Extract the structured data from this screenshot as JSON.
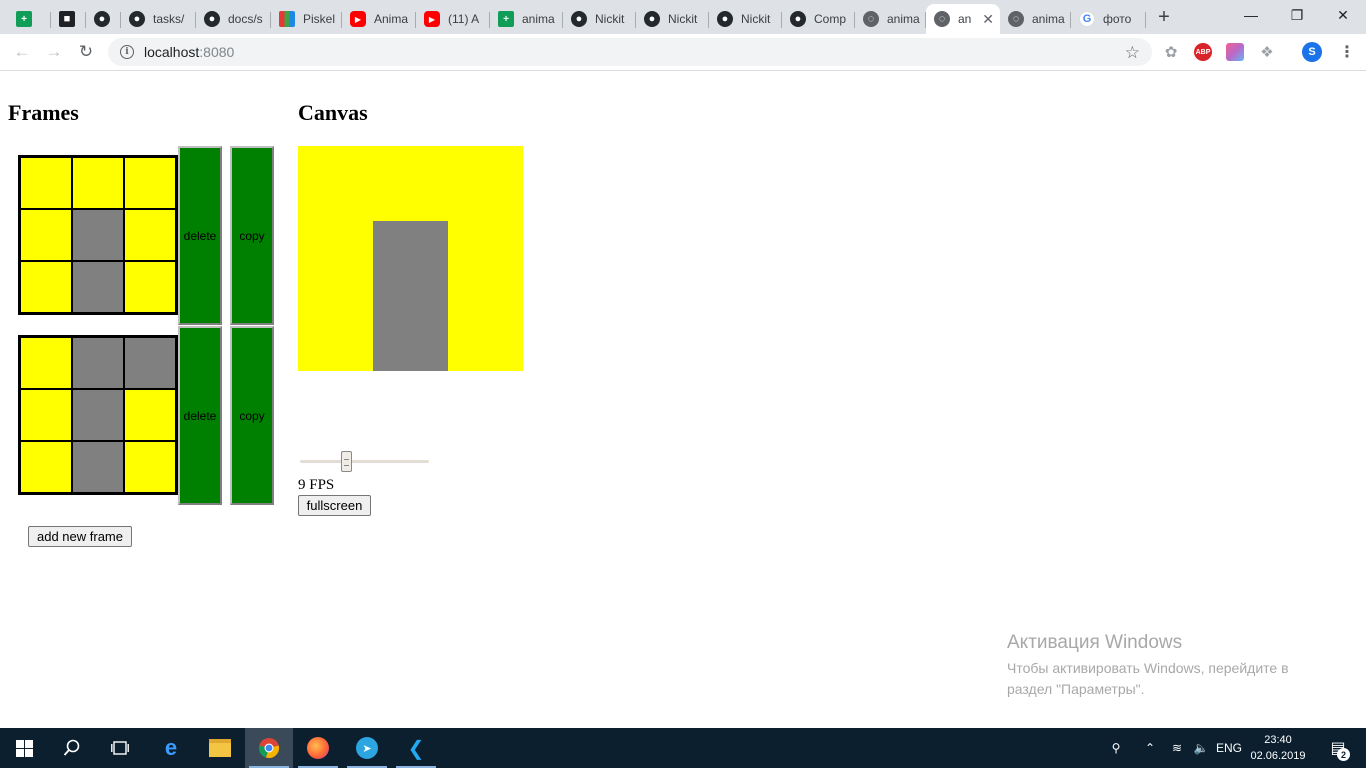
{
  "browser": {
    "tabs": [
      {
        "label": "",
        "favicon": "sheets-icon"
      },
      {
        "label": "",
        "favicon": "graduation-cap-icon"
      },
      {
        "label": "",
        "favicon": "github-icon"
      },
      {
        "label": "tasks/",
        "favicon": "github-icon"
      },
      {
        "label": "docs/s",
        "favicon": "github-icon"
      },
      {
        "label": "Piskel",
        "favicon": "piskel-grid-icon"
      },
      {
        "label": "Anima",
        "favicon": "youtube-icon"
      },
      {
        "label": "(11) A",
        "favicon": "youtube-icon"
      },
      {
        "label": "anima",
        "favicon": "sheets-icon"
      },
      {
        "label": "Nickit",
        "favicon": "github-icon"
      },
      {
        "label": "Nickit",
        "favicon": "github-icon"
      },
      {
        "label": "Nickit",
        "favicon": "github-icon"
      },
      {
        "label": "Comp",
        "favicon": "github-icon"
      },
      {
        "label": "anima",
        "favicon": "globe-icon"
      },
      {
        "label": "an",
        "favicon": "globe-icon",
        "active": true
      },
      {
        "label": "anima",
        "favicon": "globe-icon"
      },
      {
        "label": "фото",
        "favicon": "google-icon"
      }
    ],
    "address": {
      "host": "localhost",
      "port": ":8080"
    },
    "avatar_letter": "S",
    "abp_label": "ABP"
  },
  "page": {
    "frames_heading": "Frames",
    "canvas_heading": "Canvas",
    "frames": [
      {
        "cells": [
          "yellow",
          "yellow",
          "yellow",
          "yellow",
          "gray",
          "yellow",
          "yellow",
          "gray",
          "yellow"
        ],
        "delete_label": "delete",
        "copy_label": "copy"
      },
      {
        "cells": [
          "yellow",
          "gray",
          "gray",
          "yellow",
          "gray",
          "yellow",
          "yellow",
          "gray",
          "yellow"
        ],
        "delete_label": "delete",
        "copy_label": "copy"
      }
    ],
    "add_frame_label": "add new frame",
    "fps": {
      "value": 9,
      "label": "9 FPS",
      "min": 1,
      "max": 24
    },
    "fullscreen_label": "fullscreen",
    "colors": {
      "yellow": "#ffff00",
      "gray": "#808080",
      "green": "#008000"
    }
  },
  "watermark": {
    "title": "Активация Windows",
    "line1": "Чтобы активировать Windows, перейдите в",
    "line2": "раздел \"Параметры\"."
  },
  "taskbar": {
    "language": "ENG",
    "time": "23:40",
    "date": "02.06.2019",
    "notifications": "2"
  }
}
